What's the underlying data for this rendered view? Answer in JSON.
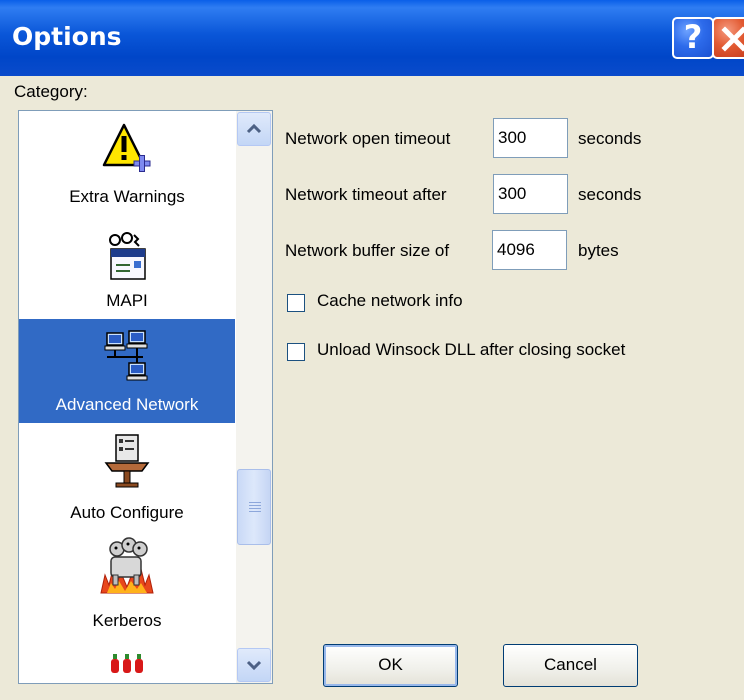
{
  "window": {
    "title": "Options",
    "help_glyph": "?",
    "close_icon": "close-icon"
  },
  "category": {
    "label": "Category:",
    "items": [
      {
        "label": "Extra Warnings",
        "icon": "warning-plus-icon",
        "selected": false
      },
      {
        "label": "MAPI",
        "icon": "mapi-envelope-icon",
        "selected": false
      },
      {
        "label": "Advanced Network",
        "icon": "network-computers-icon",
        "selected": true
      },
      {
        "label": "Auto Configure",
        "icon": "auto-configure-icon",
        "selected": false
      },
      {
        "label": "Kerberos",
        "icon": "kerberos-dog-icon",
        "selected": false
      },
      {
        "label": "",
        "icon": "peppers-icon",
        "selected": false
      }
    ]
  },
  "settings": {
    "open_timeout": {
      "label": "Network open timeout",
      "value": "300",
      "unit": "seconds"
    },
    "timeout_after": {
      "label": "Network timeout after",
      "value": "300",
      "unit": "seconds"
    },
    "buffer_size": {
      "label": "Network buffer size of",
      "value": "4096",
      "unit": "bytes"
    },
    "cache_network_info": {
      "label": "Cache network info",
      "checked": false
    },
    "unload_winsock": {
      "label": "Unload Winsock DLL after closing socket",
      "checked": false
    }
  },
  "buttons": {
    "ok": "OK",
    "cancel": "Cancel"
  },
  "colors": {
    "title_bar": "#0A56D8",
    "selection": "#316AC5",
    "dialog_bg": "#ECE9D8"
  }
}
